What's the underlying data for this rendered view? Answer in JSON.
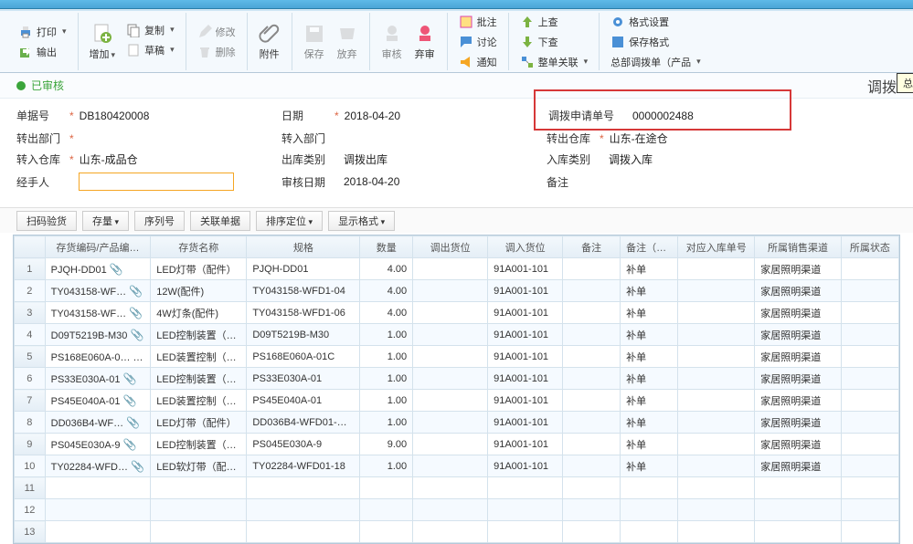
{
  "ribbon": {
    "print": "打印",
    "output": "输出",
    "add": "增加",
    "copy": "复制",
    "draft": "草稿",
    "modify": "修改",
    "delete": "删除",
    "attach": "附件",
    "save": "保存",
    "open": "放弃",
    "submit": "弃审",
    "audit": "审核",
    "approve": "批注",
    "discuss": "讨论",
    "notify": "通知",
    "prev": "上查",
    "next": "下查",
    "related": "整单关联",
    "fmt": "格式设置",
    "savefmt": "保存格式",
    "fullbar": "总部调拨单（产品"
  },
  "status": {
    "label": "已审核",
    "docType": "调拨",
    "tip": "总部调拨单（产品描述）"
  },
  "form": {
    "billNoLbl": "单据号",
    "billNo": "DB180420008",
    "dateLbl": "日期",
    "date": "2018-04-20",
    "reqNoLbl": "调拨申请单号",
    "reqNo": "0000002488",
    "outDeptLbl": "转出部门",
    "inDeptLbl": "转入部门",
    "outWhLbl": "转出仓库",
    "outWh": "山东-在途仓",
    "inWhLbl": "转入仓库",
    "inWh": "山东-成品仓",
    "outTypeLbl": "出库类别",
    "outType": "调拨出库",
    "inTypeLbl": "入库类别",
    "inType": "调拨入库",
    "handlerLbl": "经手人",
    "auditDateLbl": "审核日期",
    "auditDate": "2018-04-20",
    "remarkLbl": "备注"
  },
  "toolbar2": {
    "scan": "扫码验货",
    "stock": "存量",
    "serial": "序列号",
    "link": "关联单据",
    "sort": "排序定位",
    "display": "显示格式"
  },
  "grid": {
    "headers": {
      "code": "存货编码/产品编…",
      "name": "存货名称",
      "spec": "规格",
      "qty": "数量",
      "outLoc": "调出货位",
      "inLoc": "调入货位",
      "note": "备注",
      "stop": "备注（停…",
      "relIn": "对应入库单号",
      "channel": "所属销售渠道",
      "status": "所属状态"
    },
    "rows": [
      {
        "n": "1",
        "code": "PJQH-DD01",
        "name": "LED灯带（配件）",
        "spec": "PJQH-DD01",
        "qty": "4.00",
        "inLoc": "91A001-101",
        "stop": "补单",
        "chan": "家居照明渠道"
      },
      {
        "n": "2",
        "code": "TY043158-WF…",
        "name": "12W(配件)",
        "spec": "TY043158-WFD1-04",
        "qty": "4.00",
        "inLoc": "91A001-101",
        "stop": "补单",
        "chan": "家居照明渠道"
      },
      {
        "n": "3",
        "code": "TY043158-WF…",
        "name": "4W灯条(配件)",
        "spec": "TY043158-WFD1-06",
        "qty": "4.00",
        "inLoc": "91A001-101",
        "stop": "补单",
        "chan": "家居照明渠道"
      },
      {
        "n": "4",
        "code": "D09T5219B-M30",
        "name": "LED控制装置（…",
        "spec": "D09T5219B-M30",
        "qty": "1.00",
        "inLoc": "91A001-101",
        "stop": "补单",
        "chan": "家居照明渠道"
      },
      {
        "n": "5",
        "code": "PS168E060A-0…",
        "name": "LED装置控制（…",
        "spec": "PS168E060A-01C",
        "qty": "1.00",
        "inLoc": "91A001-101",
        "stop": "补单",
        "chan": "家居照明渠道"
      },
      {
        "n": "6",
        "code": "PS33E030A-01",
        "name": "LED控制装置（…",
        "spec": "PS33E030A-01",
        "qty": "1.00",
        "inLoc": "91A001-101",
        "stop": "补单",
        "chan": "家居照明渠道"
      },
      {
        "n": "7",
        "code": "PS45E040A-01",
        "name": "LED装置控制（…",
        "spec": "PS45E040A-01",
        "qty": "1.00",
        "inLoc": "91A001-101",
        "stop": "补单",
        "chan": "家居照明渠道"
      },
      {
        "n": "8",
        "code": "DD036B4-WF…",
        "name": "LED灯带（配件）",
        "spec": "DD036B4-WFD01-…",
        "qty": "1.00",
        "inLoc": "91A001-101",
        "stop": "补单",
        "chan": "家居照明渠道"
      },
      {
        "n": "9",
        "code": "PS045E030A-9",
        "name": "LED控制装置（…",
        "spec": "PS045E030A-9",
        "qty": "9.00",
        "inLoc": "91A001-101",
        "stop": "补单",
        "chan": "家居照明渠道"
      },
      {
        "n": "10",
        "code": "TY02284-WFD…",
        "name": "LED软灯带（配…",
        "spec": "TY02284-WFD01-18",
        "qty": "1.00",
        "inLoc": "91A001-101",
        "stop": "补单",
        "chan": "家居照明渠道"
      },
      {
        "n": "11"
      },
      {
        "n": "12"
      },
      {
        "n": "13"
      }
    ]
  }
}
